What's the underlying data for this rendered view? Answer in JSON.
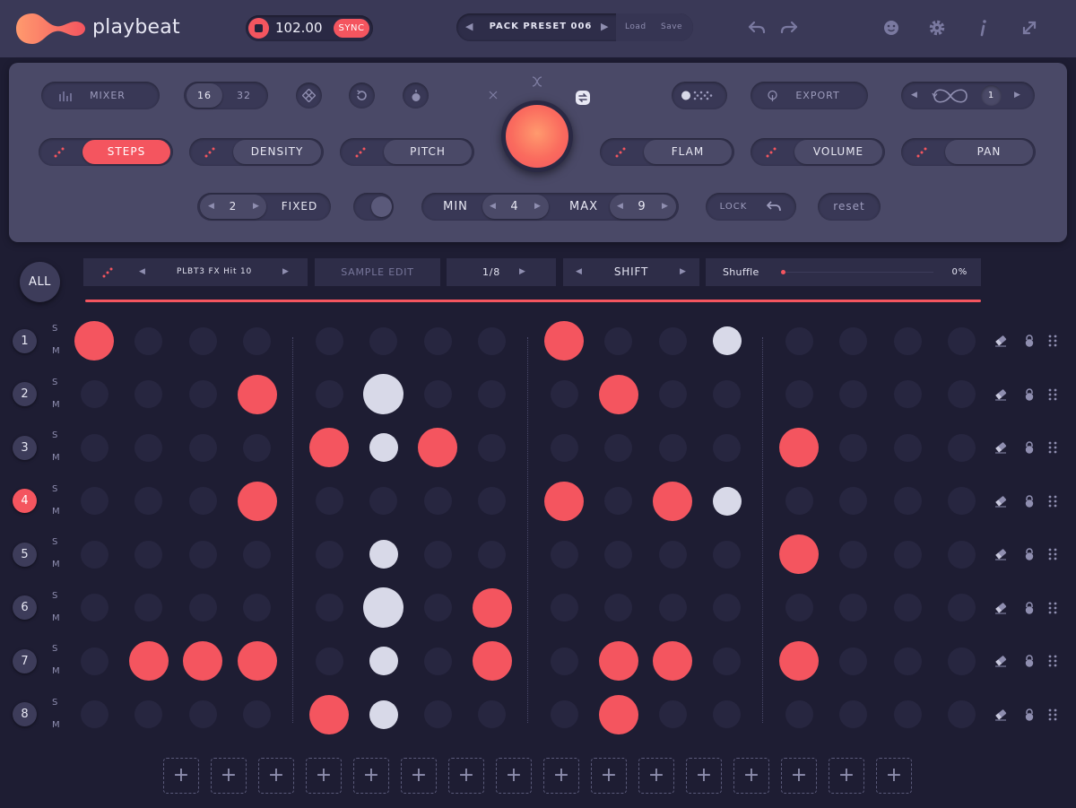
{
  "app": {
    "name": "playbeat"
  },
  "transport": {
    "bpm": "102.00",
    "sync_label": "SYNC"
  },
  "preset": {
    "name": "PACK PRESET 006",
    "load_label": "Load",
    "save_label": "Save"
  },
  "top_icons": [
    "undo-icon",
    "redo-icon",
    "face-icon",
    "gear-icon",
    "info-icon",
    "resize-icon"
  ],
  "panel": {
    "mixer_label": "MIXER",
    "steps_16": "16",
    "steps_32": "32",
    "export_label": "EXPORT",
    "loop_count": "1",
    "param_buttons": [
      "STEPS",
      "DENSITY",
      "PITCH",
      "FLAM",
      "VOLUME",
      "PAN"
    ],
    "active_param": "STEPS",
    "fixed_value": "2",
    "fixed_label": "FIXED",
    "min_label": "MIN",
    "min_value": "4",
    "max_label": "MAX",
    "max_value": "9",
    "lock_label": "LOCK",
    "reset_label": "reset"
  },
  "track_header": {
    "all_label": "ALL",
    "sample_name": "PLBT3 FX Hit 10",
    "sample_edit_label": "SAMPLE EDIT",
    "division": "1/8",
    "shift_label": "SHIFT",
    "shuffle_label": "Shuffle",
    "shuffle_value": "0%",
    "shuffle_amount": 0
  },
  "rows": [
    {
      "num": "1",
      "active": false,
      "steps": [
        2,
        0,
        0,
        0,
        0,
        0,
        0,
        0,
        2,
        0,
        0,
        1,
        0,
        0,
        0,
        0
      ]
    },
    {
      "num": "2",
      "active": false,
      "steps": [
        0,
        0,
        0,
        2,
        0,
        3,
        0,
        0,
        0,
        2,
        0,
        0,
        0,
        0,
        0,
        0
      ]
    },
    {
      "num": "3",
      "active": false,
      "steps": [
        0,
        0,
        0,
        0,
        2,
        1,
        2,
        0,
        0,
        0,
        0,
        0,
        2,
        0,
        0,
        0
      ]
    },
    {
      "num": "4",
      "active": true,
      "steps": [
        0,
        0,
        0,
        2,
        0,
        0,
        0,
        0,
        2,
        0,
        2,
        1,
        0,
        0,
        0,
        0
      ]
    },
    {
      "num": "5",
      "active": false,
      "steps": [
        0,
        0,
        0,
        0,
        0,
        1,
        0,
        0,
        0,
        0,
        0,
        0,
        2,
        0,
        0,
        0
      ]
    },
    {
      "num": "6",
      "active": false,
      "steps": [
        0,
        0,
        0,
        0,
        0,
        3,
        0,
        2,
        0,
        0,
        0,
        0,
        0,
        0,
        0,
        0
      ]
    },
    {
      "num": "7",
      "active": false,
      "steps": [
        0,
        2,
        2,
        2,
        0,
        1,
        0,
        2,
        0,
        2,
        2,
        0,
        2,
        0,
        0,
        0
      ]
    },
    {
      "num": "8",
      "active": false,
      "steps": [
        0,
        0,
        0,
        0,
        2,
        1,
        0,
        0,
        0,
        2,
        0,
        0,
        0,
        0,
        0,
        0
      ]
    }
  ],
  "solo_label": "S",
  "mute_label": "M",
  "add_slot_label": "+",
  "colors": {
    "accent": "#f4555f",
    "ghost": "#d8d9e8",
    "background": "#1e1d33",
    "panel": "#4a4967"
  }
}
